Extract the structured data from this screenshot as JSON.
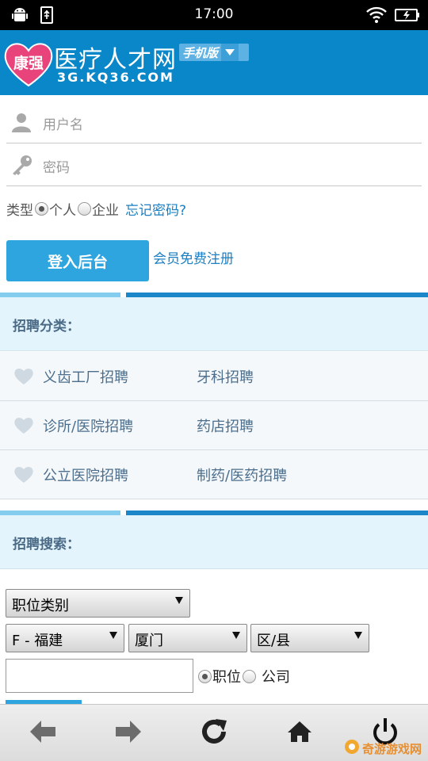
{
  "status_bar": {
    "time": "17:00"
  },
  "header": {
    "logo_badge_text": "康强",
    "title": "医疗人才网",
    "domain": "3G.KQ36.COM",
    "version_label": "手机版"
  },
  "login": {
    "username_placeholder": "用户名",
    "password_placeholder": "密码",
    "type_label": "类型",
    "option_personal": "个人",
    "option_company": "企业",
    "forgot_link": "忘记密码?",
    "submit_label": "登入后台",
    "register_link": "会员免费注册"
  },
  "categories": {
    "heading": "招聘分类：",
    "rows": [
      {
        "left": "义齿工厂招聘",
        "right": "牙科招聘"
      },
      {
        "left": "诊所/医院招聘",
        "right": "药店招聘"
      },
      {
        "left": "公立医院招聘",
        "right": "制药/医药招聘"
      }
    ]
  },
  "search": {
    "heading": "招聘搜索：",
    "job_type": "职位类别",
    "province": "F - 福建",
    "city": "厦门",
    "district": "区/县",
    "keyword_value": "",
    "option_job": "职位",
    "option_company": "公司"
  },
  "watermark": "奇游游戏网",
  "colors": {
    "header": "#0a87c9",
    "accent": "#2ea5de",
    "link": "#1b7fc1",
    "section_bg": "#e4f4fd"
  }
}
